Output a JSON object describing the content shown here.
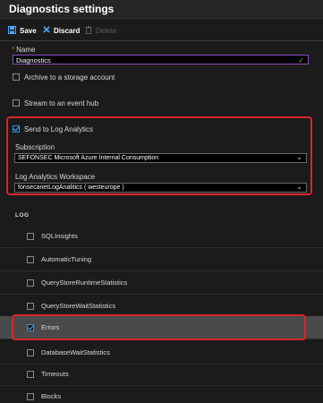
{
  "header": {
    "title": "Diagnostics settings"
  },
  "toolbar": {
    "save_label": "Save",
    "discard_label": "Discard",
    "delete_label": "Delete"
  },
  "form": {
    "name_label": "Name",
    "name_value": "Diagnostics",
    "archive_label": "Archive to a storage account",
    "archive_checked": false,
    "stream_label": "Stream to an event hub",
    "stream_checked": false,
    "send_label": "Send to Log Analytics",
    "send_checked": true,
    "subscription_label": "Subscription",
    "subscription_value": "SEFONSEC Microsoft Azure Internal Consumption",
    "workspace_label": "Log Analytics Workspace",
    "workspace_value": "fonsecanetLogAnalitics ( westeurope )"
  },
  "log": {
    "section_label": "LOG",
    "items": [
      {
        "label": "SQLInsights",
        "checked": false
      },
      {
        "label": "AutomaticTuning",
        "checked": false
      },
      {
        "label": "QueryStoreRuntimeStatistics",
        "checked": false
      },
      {
        "label": "QueryStoreWaitStatistics",
        "checked": false
      },
      {
        "label": "Errors",
        "checked": true
      },
      {
        "label": "DatabaseWaitStatistics",
        "checked": false
      },
      {
        "label": "Timeouts",
        "checked": false
      },
      {
        "label": "Blocks",
        "checked": false
      }
    ]
  },
  "colors": {
    "accent": "#2f8fe0",
    "highlight_border": "#d9262c",
    "name_border": "#8b4fbf"
  }
}
